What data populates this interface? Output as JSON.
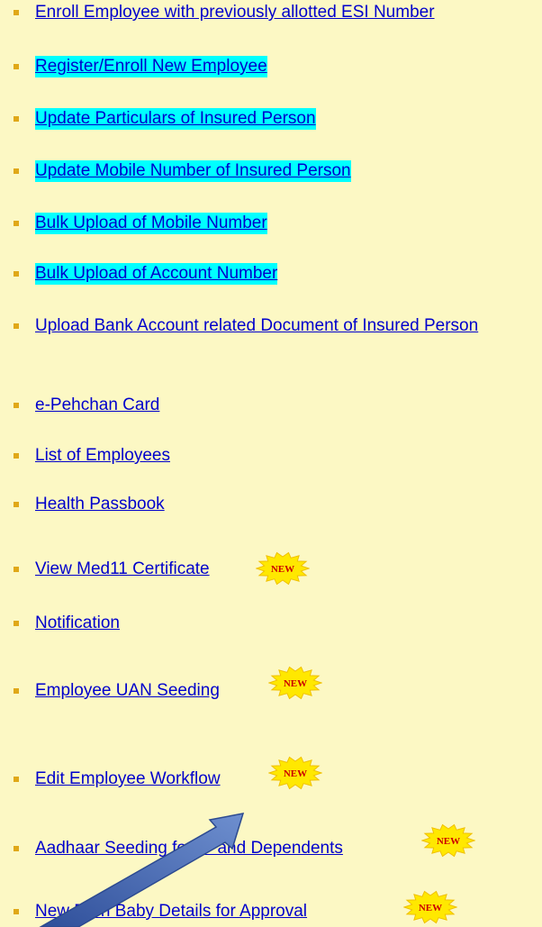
{
  "menu": {
    "items": [
      {
        "label": "Enroll Employee with previously allotted ESI Number",
        "highlighted": false,
        "is_new": false
      },
      {
        "label": "Register/Enroll New Employee",
        "highlighted": true,
        "is_new": false
      },
      {
        "label": "Update Particulars of Insured Person",
        "highlighted": true,
        "is_new": false
      },
      {
        "label": "Update Mobile Number of Insured Person",
        "highlighted": true,
        "is_new": false
      },
      {
        "label": "Bulk Upload of Mobile Number",
        "highlighted": true,
        "is_new": false
      },
      {
        "label": "Bulk Upload of Account Number",
        "highlighted": true,
        "is_new": false
      },
      {
        "label": "Upload Bank Account related Document of Insured Person",
        "highlighted": false,
        "is_new": false
      },
      {
        "label": "e-Pehchan Card",
        "highlighted": false,
        "is_new": false
      },
      {
        "label": "List of Employees",
        "highlighted": false,
        "is_new": false
      },
      {
        "label": "Health Passbook",
        "highlighted": false,
        "is_new": false
      },
      {
        "label": "View Med11 Certificate",
        "highlighted": false,
        "is_new": true
      },
      {
        "label": "Notification",
        "highlighted": false,
        "is_new": false
      },
      {
        "label": "Employee UAN Seeding",
        "highlighted": false,
        "is_new": true
      },
      {
        "label": "Edit Employee Workflow",
        "highlighted": false,
        "is_new": true
      },
      {
        "label": "Aadhaar Seeding for IP and Dependents",
        "highlighted": false,
        "is_new": true
      },
      {
        "label": "New Born Baby Details for Approval",
        "highlighted": false,
        "is_new": true
      }
    ],
    "new_badge_text": "NEW"
  },
  "colors": {
    "background": "#fcf8c4",
    "link": "#0000cc",
    "highlight": "#00ffff",
    "bullet": "#e0a818",
    "badge_fill": "#ffe800",
    "badge_text": "#cc0000",
    "arrow": "#4a6fb4"
  }
}
